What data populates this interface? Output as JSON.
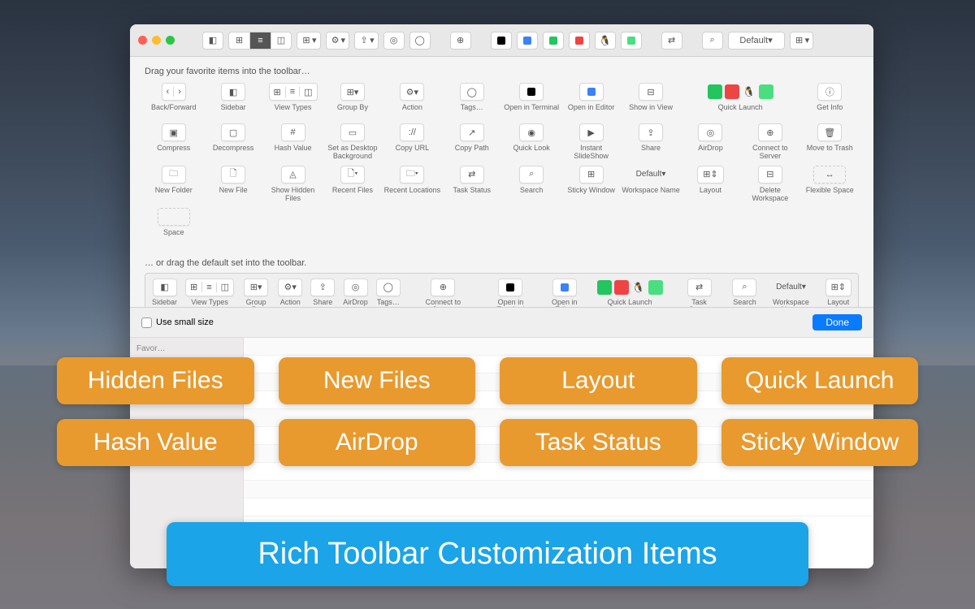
{
  "titlebar": {
    "workspace_name": "Default"
  },
  "sheet": {
    "instruction_top": "Drag your favorite items into the toolbar…",
    "instruction_bottom": "… or drag the default set into the toolbar.",
    "use_small_size": "Use small size",
    "done": "Done"
  },
  "palette_rows": [
    [
      "Back/Forward",
      "Sidebar",
      "View Types",
      "Group By",
      "Action",
      "Tags…",
      "Open in Terminal",
      "Open in Editor",
      "Show in View",
      "Quick Launch",
      "",
      "Get Info"
    ],
    [
      "Compress",
      "Decompress",
      "Hash Value",
      "Set as Desktop Background",
      "Copy URL",
      "Copy Path",
      "Quick Look",
      "Instant SlideShow",
      "Share",
      "AirDrop",
      "Connect to Server",
      "Move to Trash"
    ],
    [
      "New Folder",
      "New File",
      "Show Hidden Files",
      "Recent Files",
      "Recent Locations",
      "Task Status",
      "Search",
      "Sticky Window",
      "Workspace Name",
      "Layout",
      "Delete Workspace",
      "Flexible Space"
    ],
    [
      "Space",
      "",
      "",
      "",
      "",
      "",
      "",
      "",
      "",
      "",
      "",
      ""
    ]
  ],
  "default_bar": [
    "Sidebar",
    "View Types",
    "Group By",
    "Action",
    "Share",
    "AirDrop",
    "Tags…",
    "Connect to Server",
    "Open in Terminal",
    "Open in Editor",
    "Quick Launch",
    "",
    "Task Status",
    "Search",
    "Workspace Name",
    "Layout"
  ],
  "sidebar": {
    "heading": "Favor…"
  },
  "callouts_row1": [
    "Hidden Files",
    "New Files",
    "Layout",
    "Quick Launch"
  ],
  "callouts_row2": [
    "Hash Value",
    "AirDrop",
    "Task Status",
    "Sticky Window"
  ],
  "banner": "Rich Toolbar Customization Items"
}
